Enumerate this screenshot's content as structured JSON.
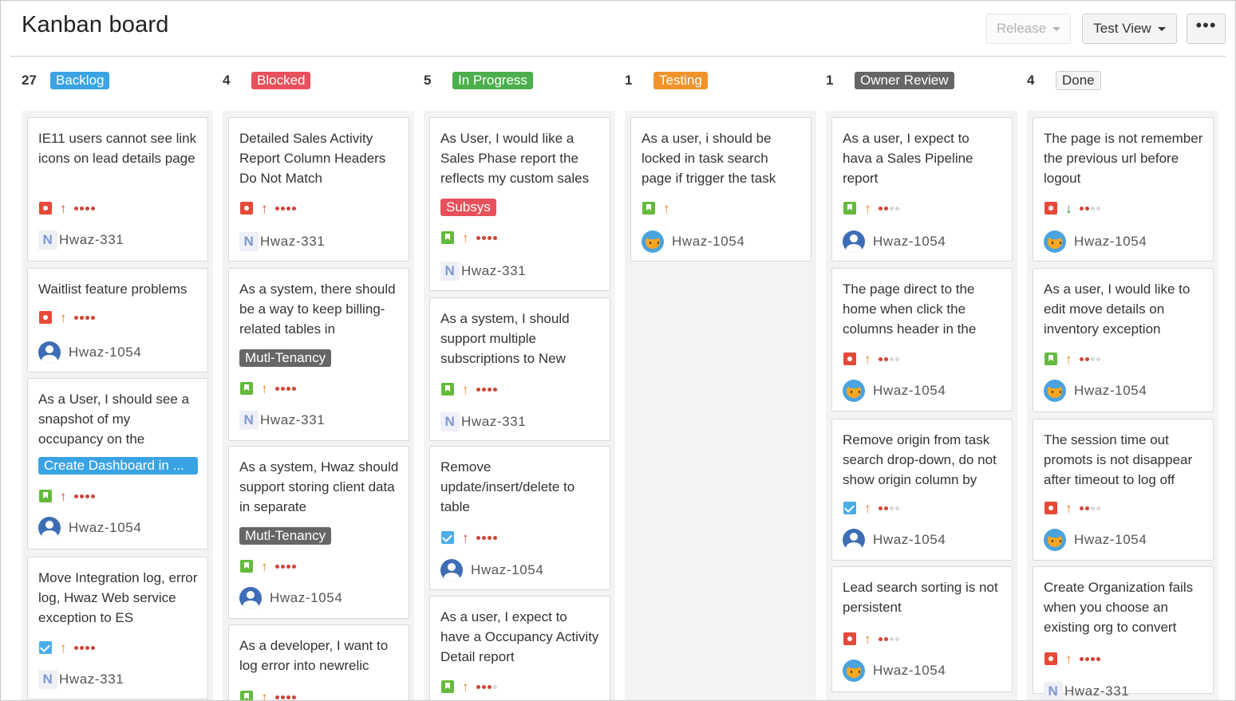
{
  "header": {
    "title": "Kanban board",
    "release_label": "Release",
    "view_label": "Test View",
    "more_label": "•••"
  },
  "columns": [
    {
      "count": "27",
      "label": "Backlog",
      "color": "#3aa3e3",
      "cards": [
        {
          "title": "IE11 users cannot see link icons on lead details page",
          "type": "bug",
          "priority": "high",
          "prio": "↑",
          "level": 4,
          "assignee": "Hwaz-331",
          "avatar": "n-icon"
        },
        {
          "title": "Waitlist feature problems",
          "type": "bug",
          "priority": "med",
          "prio": "↑",
          "level": 4,
          "assignee": "Hwaz-1054",
          "avatar": "user-icon"
        },
        {
          "title": "As a User, I should see a snapshot of my occupancy on the",
          "tag": "Create Dashboard in ...",
          "tagColor": "#3aa3e3",
          "type": "story",
          "priority": "high",
          "prio": "↑",
          "level": 4,
          "assignee": "Hwaz-1054",
          "avatar": "user-icon"
        },
        {
          "title": "Move Integration log, error log, Hwaz Web service exception to ES",
          "type": "task",
          "priority": "med",
          "prio": "↑",
          "level": 4,
          "assignee": "Hwaz-331",
          "avatar": "n-icon"
        }
      ]
    },
    {
      "count": "4",
      "label": "Blocked",
      "color": "#e8505b",
      "cards": [
        {
          "title": "Detailed Sales Activity Report Column Headers Do Not Match",
          "type": "bug",
          "priority": "high",
          "prio": "↑",
          "level": 4,
          "assignee": "Hwaz-331",
          "avatar": "n-icon"
        },
        {
          "title": "As a system, there should be a way to keep billing-related tables in",
          "tag": "Mutl-Tenancy",
          "tagColor": "#666666",
          "type": "story",
          "priority": "med",
          "prio": "↑",
          "level": 4,
          "assignee": "Hwaz-331",
          "avatar": "n-icon"
        },
        {
          "title": "As a system, Hwaz should support storing client data in separate",
          "tag": "Mutl-Tenancy",
          "tagColor": "#666666",
          "type": "story",
          "priority": "med",
          "prio": "↑",
          "level": 4,
          "assignee": "Hwaz-1054",
          "avatar": "user-icon"
        },
        {
          "title": "As a developer, I want to log error into newrelic",
          "type": "story",
          "priority": "med",
          "prio": "↑",
          "level": 4,
          "assignee": "",
          "avatar": ""
        }
      ]
    },
    {
      "count": "5",
      "label": "In Progress",
      "color": "#4cae4c",
      "cards": [
        {
          "title": "As User, I would like a Sales Phase report the reflects my custom sales",
          "tag": "Subsys",
          "tagColor": "#e8505b",
          "type": "story",
          "priority": "med",
          "prio": "↑",
          "level": 4,
          "assignee": "Hwaz-331",
          "avatar": "n-icon"
        },
        {
          "title": "As a system, I should support multiple subscriptions to New",
          "type": "story",
          "priority": "med",
          "prio": "↑",
          "level": 4,
          "assignee": "Hwaz-331",
          "avatar": "n-icon"
        },
        {
          "title": "Remove update/insert/delete to table",
          "type": "task",
          "priority": "high",
          "prio": "↑",
          "level": 4,
          "assignee": "Hwaz-1054",
          "avatar": "user-icon"
        },
        {
          "title": "As a user, I expect to have a Occupancy Activity Detail report",
          "type": "story",
          "priority": "med",
          "prio": "↑",
          "level": 3,
          "assignee": "",
          "avatar": ""
        }
      ]
    },
    {
      "count": "1",
      "label": "Testing",
      "color": "#f0932b",
      "cards": [
        {
          "title": "As a user, i should be locked in task search page if trigger the task",
          "type": "story",
          "priority": "med",
          "prio": "↑",
          "level": 0,
          "assignee": "Hwaz-1054",
          "avatar": "cat-icon"
        }
      ]
    },
    {
      "count": "1",
      "label": "Owner Review",
      "color": "#666666",
      "cards": [
        {
          "title": "As a user, I expect to hava a Sales Pipeline report",
          "type": "story",
          "priority": "med",
          "prio": "↑",
          "level": 2,
          "assignee": "Hwaz-1054",
          "avatar": "user-icon"
        },
        {
          "title": "The page direct to the home when click the columns header in the",
          "type": "bug",
          "priority": "med",
          "prio": "↑",
          "level": 2,
          "assignee": "Hwaz-1054",
          "avatar": "cat-icon"
        },
        {
          "title": "Remove origin from task search drop-down, do not show origin column by",
          "type": "task",
          "priority": "med",
          "prio": "↑",
          "level": 2,
          "assignee": "Hwaz-1054",
          "avatar": "user-icon"
        },
        {
          "title": "Lead search sorting is not persistent",
          "type": "bug",
          "priority": "med",
          "prio": "↑",
          "level": 2,
          "assignee": "Hwaz-1054",
          "avatar": "cat-icon"
        }
      ]
    },
    {
      "count": "4",
      "label": "Done",
      "color": "#f5f5f5",
      "cards": [
        {
          "title": "The page is not remember the previous url before logout",
          "type": "bug",
          "priority": "low",
          "prio": "↓",
          "level": 2,
          "assignee": "Hwaz-1054",
          "avatar": "cat-icon"
        },
        {
          "title": "As a user, I would like to edit move details on inventory exception",
          "type": "story",
          "priority": "med",
          "prio": "↑",
          "level": 2,
          "assignee": "Hwaz-1054",
          "avatar": "cat-icon"
        },
        {
          "title": "The session time out promots is not disappear after timeout to log off",
          "type": "bug",
          "priority": "med",
          "prio": "↑",
          "level": 2,
          "assignee": "Hwaz-1054",
          "avatar": "cat-icon"
        },
        {
          "title": "Create Organization fails when you choose an existing org to convert",
          "type": "bug",
          "priority": "med",
          "prio": "↑",
          "level": 4,
          "assignee": "Hwaz-331",
          "avatar": "n-icon"
        }
      ]
    }
  ]
}
